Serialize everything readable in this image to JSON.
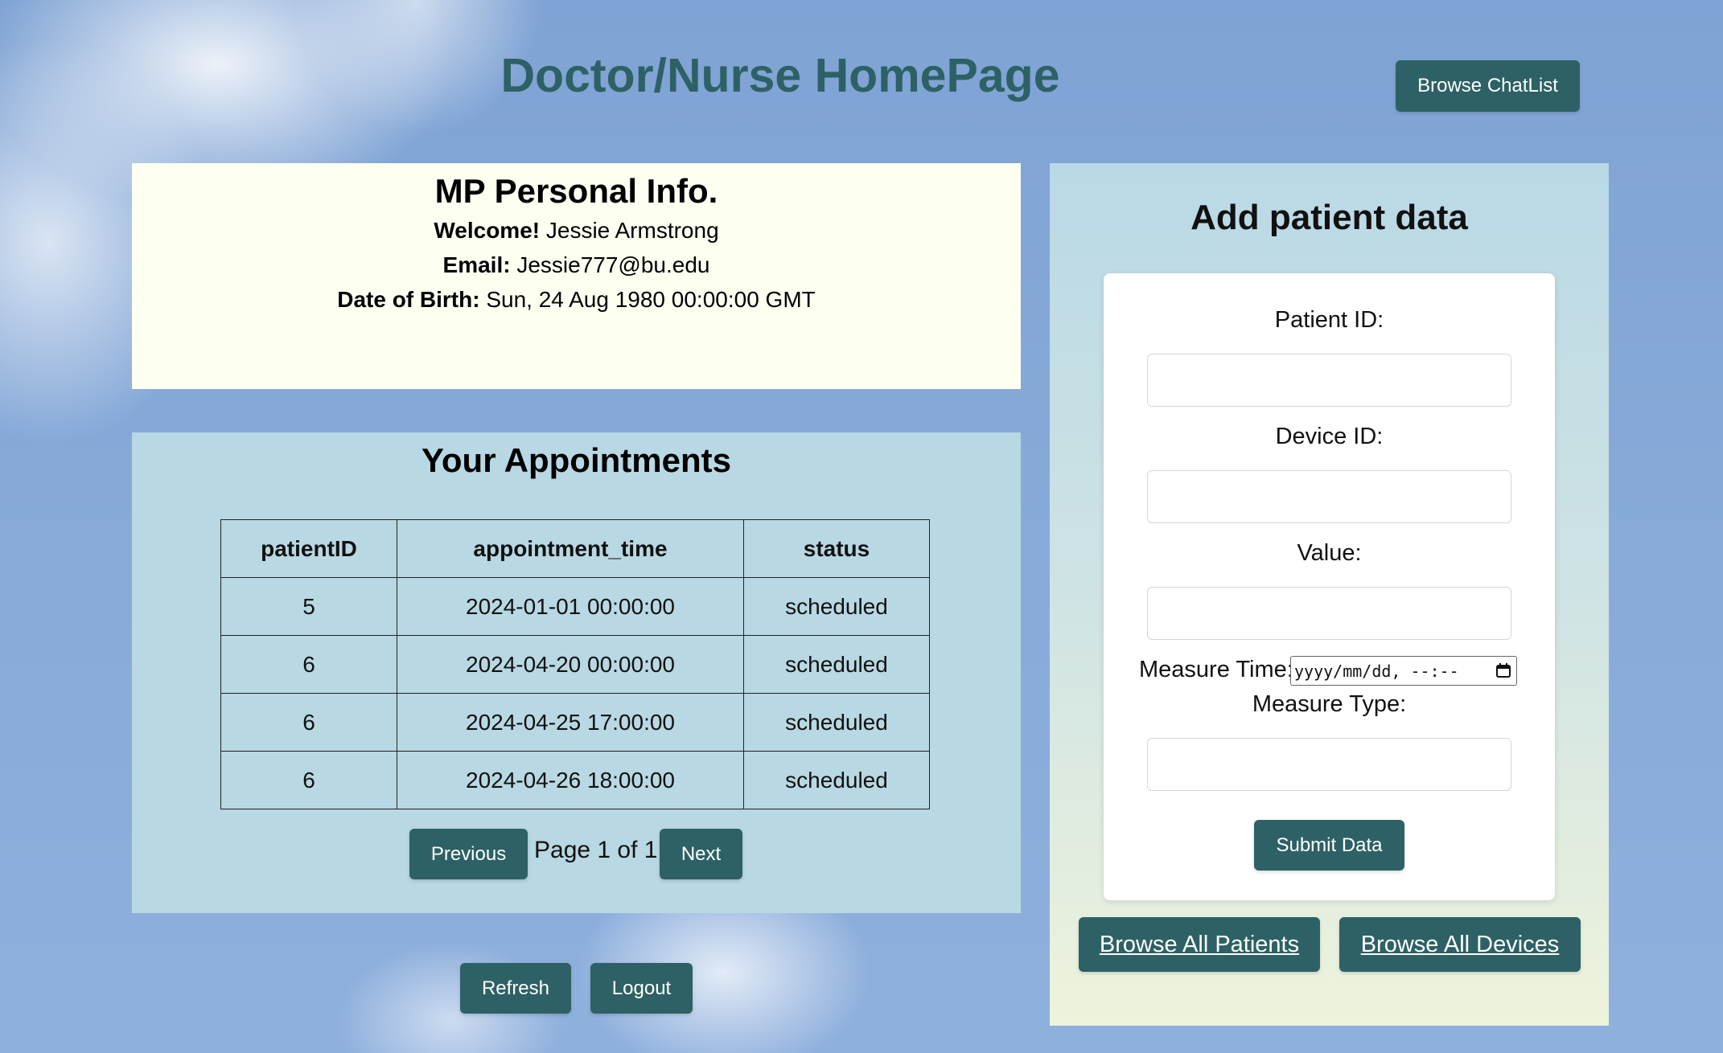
{
  "header": {
    "title": "Doctor/Nurse HomePage",
    "chatlist_button": "Browse ChatList"
  },
  "personal_info": {
    "heading": "MP Personal Info.",
    "welcome_label": "Welcome!",
    "welcome_value": "Jessie Armstrong",
    "email_label": "Email:",
    "email_value": "Jessie777@bu.edu",
    "dob_label": "Date of Birth:",
    "dob_value": "Sun, 24 Aug 1980 00:00:00 GMT"
  },
  "appointments": {
    "heading": "Your Appointments",
    "columns": [
      "patientID",
      "appointment_time",
      "status"
    ],
    "rows": [
      [
        "5",
        "2024-01-01 00:00:00",
        "scheduled"
      ],
      [
        "6",
        "2024-04-20 00:00:00",
        "scheduled"
      ],
      [
        "6",
        "2024-04-25 17:00:00",
        "scheduled"
      ],
      [
        "6",
        "2024-04-26 18:00:00",
        "scheduled"
      ]
    ],
    "prev_button": "Previous",
    "page_text": "Page 1 of 1",
    "next_button": "Next"
  },
  "bottom_buttons": {
    "refresh": "Refresh",
    "logout": "Logout"
  },
  "add_data": {
    "heading": "Add patient data",
    "patient_id_label": "Patient ID:",
    "patient_id_value": "",
    "device_id_label": "Device ID:",
    "device_id_value": "",
    "value_label": "Value:",
    "value_value": "",
    "measure_time_label": "Measure Time:",
    "measure_time_placeholder": "yyyy/mm/dd, --:--",
    "measure_type_label": "Measure Type:",
    "measure_type_value": "",
    "submit_button": "Submit Data",
    "browse_patients": "Browse All Patients",
    "browse_devices": "Browse All Devices"
  },
  "colors": {
    "accent": "#2d6165",
    "info_panel_bg": "#fdfff1",
    "appointments_bg": "#b8d8e3"
  }
}
